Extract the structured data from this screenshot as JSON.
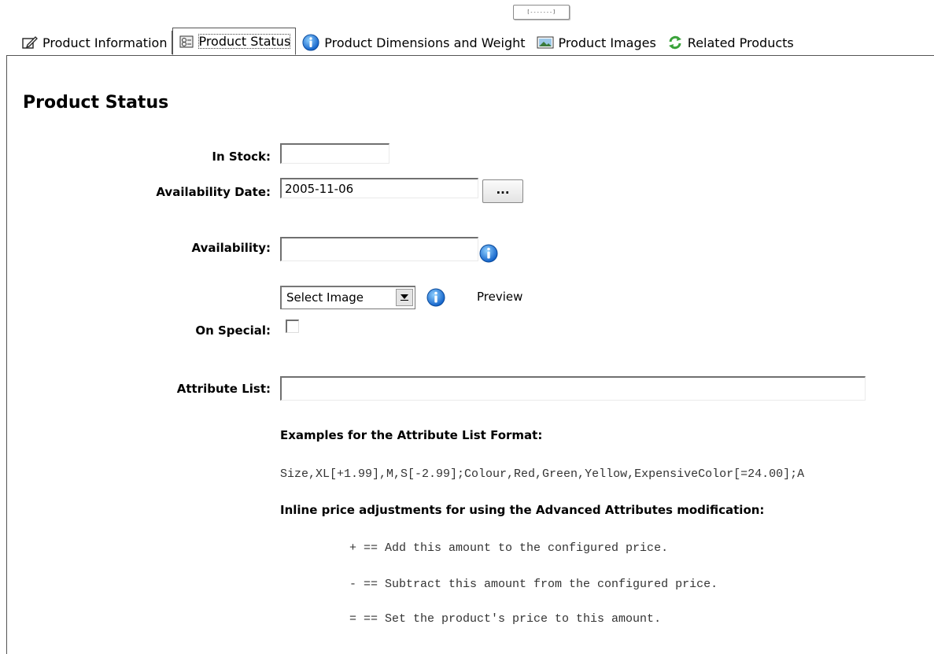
{
  "top_tag": "[-------]",
  "tabs": [
    {
      "label": "Product Information",
      "icon": "edit-icon"
    },
    {
      "label": "Product Status",
      "icon": "status-icon",
      "active": true
    },
    {
      "label": "Product Dimensions and Weight",
      "icon": "info-icon"
    },
    {
      "label": "Product Images",
      "icon": "image-icon"
    },
    {
      "label": "Related Products",
      "icon": "refresh-icon"
    }
  ],
  "page_title": "Product Status",
  "form": {
    "in_stock_label": "In Stock:",
    "in_stock_value": "",
    "availability_date_label": "Availability Date:",
    "availability_date_value": "2005-11-06",
    "date_picker_button": "...",
    "availability_label": "Availability:",
    "availability_value": "",
    "select_image_value": "Select Image",
    "preview_label": "Preview",
    "on_special_label": "On Special:",
    "on_special_checked": false,
    "attribute_list_label": "Attribute List:",
    "attribute_list_value": ""
  },
  "help": {
    "examples_title": "Examples for the Attribute List Format:",
    "example_line": "Size,XL[+1.99],M,S[-2.99];Colour,Red,Green,Yellow,ExpensiveColor[=24.00];A",
    "inline_title": "Inline price adjustments for using the Advanced Attributes modification:",
    "adjustments": [
      "+ == Add this amount to the configured price.",
      "- == Subtract this amount from the configured price.",
      "= == Set the product's price to this amount."
    ]
  },
  "colors": {
    "info_blue": "#1f6fd0",
    "border": "#555555"
  }
}
